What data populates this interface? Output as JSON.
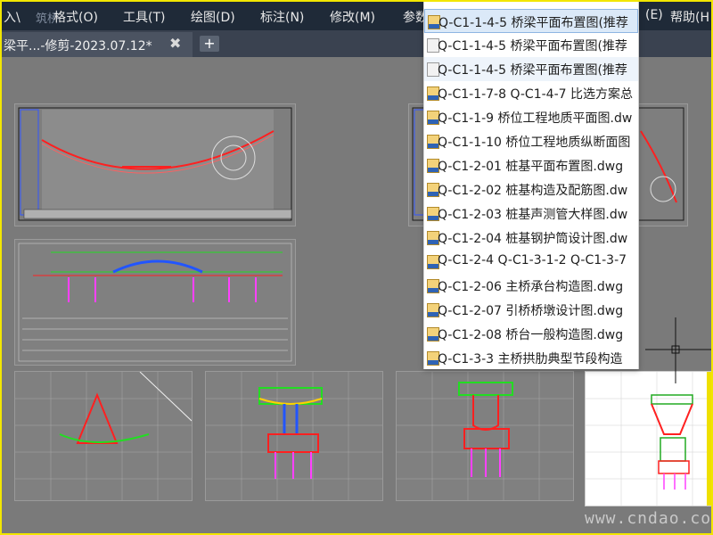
{
  "menu": {
    "items": [
      "入\\",
      "格式(O)",
      "工具(T)",
      "绘图(D)",
      "标注(N)",
      "修改(M)",
      "参数",
      "(E)",
      "帮助(H"
    ]
  },
  "logo_text": "筑桥",
  "tabs": {
    "active_label": "梁平...-修剪-2023.07.12*",
    "close_glyph": "✖",
    "new_tab_glyph": "+"
  },
  "dropdown": {
    "items": [
      {
        "label": "Q-C1-1-4-5 桥梁平面布置图(推荐",
        "icon": "dwg-file-icon",
        "state": "selected"
      },
      {
        "label": "Q-C1-1-4-5 桥梁平面布置图(推荐",
        "icon": "blank-file-icon",
        "state": "normal"
      },
      {
        "label": "Q-C1-1-4-5 桥梁平面布置图(推荐",
        "icon": "blank-file-icon",
        "state": "hover"
      },
      {
        "label": "Q-C1-1-7-8 Q-C1-4-7 比选方案总",
        "icon": "dwg-file-icon",
        "state": "normal"
      },
      {
        "label": "Q-C1-1-9 桥位工程地质平面图.dw",
        "icon": "dwg-file-icon",
        "state": "normal"
      },
      {
        "label": "Q-C1-1-10 桥位工程地质纵断面图",
        "icon": "dwg-file-icon",
        "state": "normal"
      },
      {
        "label": "Q-C1-2-01 桩基平面布置图.dwg",
        "icon": "dwg-file-icon",
        "state": "normal"
      },
      {
        "label": "Q-C1-2-02 桩基构造及配筋图.dw",
        "icon": "dwg-file-icon",
        "state": "normal"
      },
      {
        "label": "Q-C1-2-03 桩基声测管大样图.dw",
        "icon": "dwg-file-icon",
        "state": "normal"
      },
      {
        "label": "Q-C1-2-04 桩基钢护筒设计图.dw",
        "icon": "dwg-file-icon",
        "state": "normal"
      },
      {
        "label": "Q-C1-2-4 Q-C1-3-1-2 Q-C1-3-7",
        "icon": "dwg-file-icon",
        "state": "normal"
      },
      {
        "label": "Q-C1-2-06 主桥承台构造图.dwg",
        "icon": "dwg-file-icon",
        "state": "normal"
      },
      {
        "label": "Q-C1-2-07 引桥桥墩设计图.dwg",
        "icon": "dwg-file-icon",
        "state": "normal"
      },
      {
        "label": "Q-C1-2-08 桥台一般构造图.dwg",
        "icon": "dwg-file-icon",
        "state": "normal"
      },
      {
        "label": "Q-C1-3-3 主桥拱肋典型节段构造",
        "icon": "dwg-file-icon",
        "state": "normal"
      }
    ]
  },
  "watermark": "www.cndao.com",
  "colors": {
    "menubar_bg": "#1f2a38",
    "canvas_bg": "#7a7a7a",
    "frame_border": "#f2e600",
    "selection_bg": "#dbe9f8"
  }
}
